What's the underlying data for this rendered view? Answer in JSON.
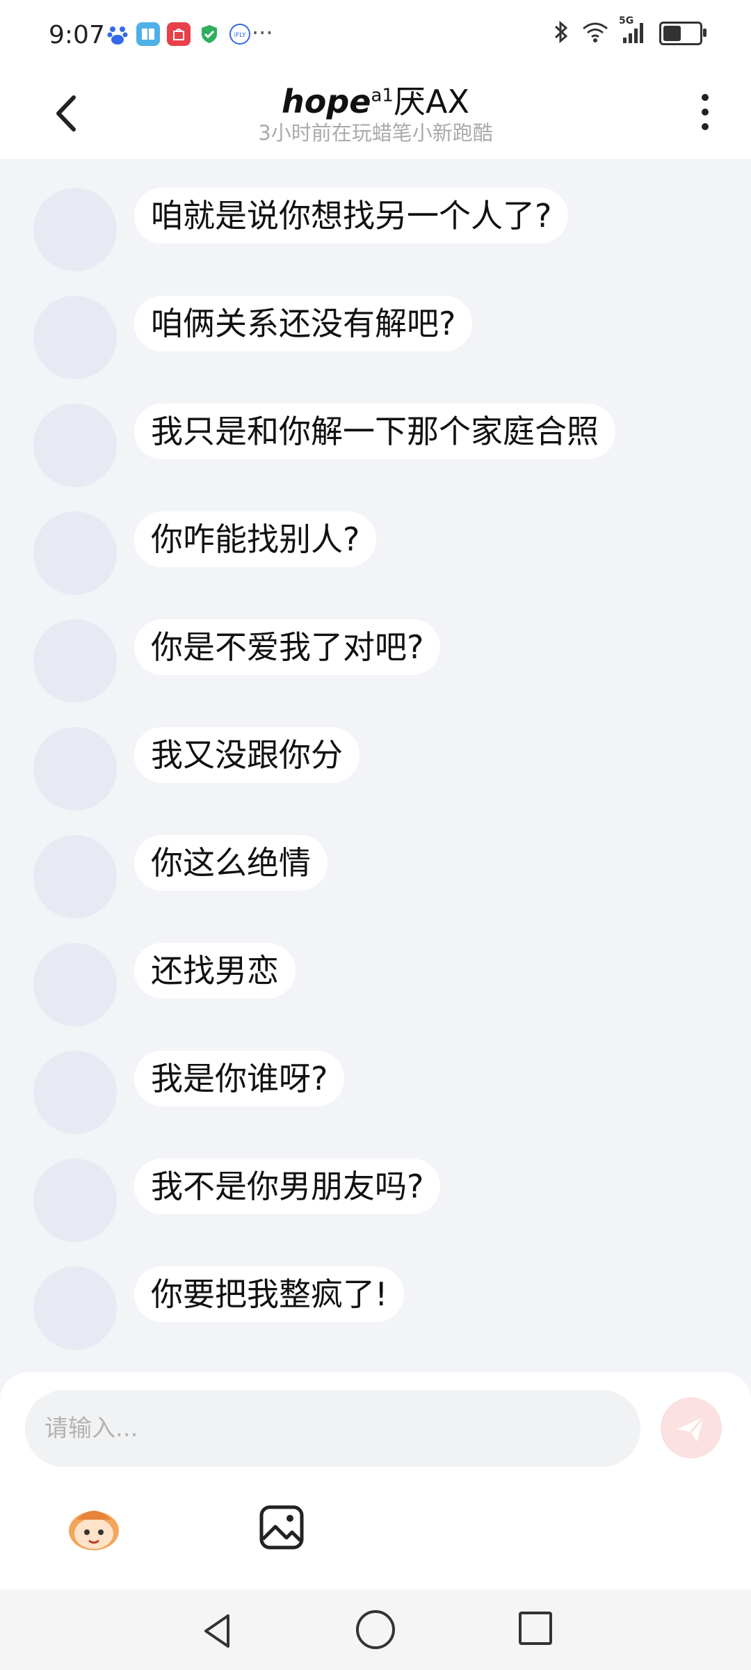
{
  "status_bar": {
    "time": "9:07",
    "network": "5G",
    "battery_level": 0.5,
    "icons_left": [
      "baidu-icon",
      "book-app-icon",
      "huawei-store-icon",
      "security-icon",
      "ifly-icon"
    ],
    "icons_right": [
      "bluetooth-icon",
      "wifi-icon",
      "signal-icon",
      "battery-icon"
    ]
  },
  "header": {
    "name_main": "hope",
    "name_sup": "a1",
    "name_suffix": "厌AX",
    "subtitle": "3小时前在玩蜡笔小新跑酷"
  },
  "messages": [
    {
      "text": "咱就是说你想找另一个人了?"
    },
    {
      "text": "咱俩关系还没有解吧?"
    },
    {
      "text": "我只是和你解一下那个家庭合照"
    },
    {
      "text": "你咋能找别人?"
    },
    {
      "text": "你是不爱我了对吧?"
    },
    {
      "text": "我又没跟你分"
    },
    {
      "text": "你这么绝情"
    },
    {
      "text": "还找男恋"
    },
    {
      "text": "我是你谁呀?"
    },
    {
      "text": "我不是你男朋友吗?"
    },
    {
      "text": "你要把我整疯了!"
    }
  ],
  "composer": {
    "placeholder": "请输入...",
    "value": ""
  },
  "colors": {
    "background": "#f2f4f7",
    "bubble": "#ffffff",
    "avatar": "#e8eaf3",
    "send_button": "#fbe1e1"
  }
}
